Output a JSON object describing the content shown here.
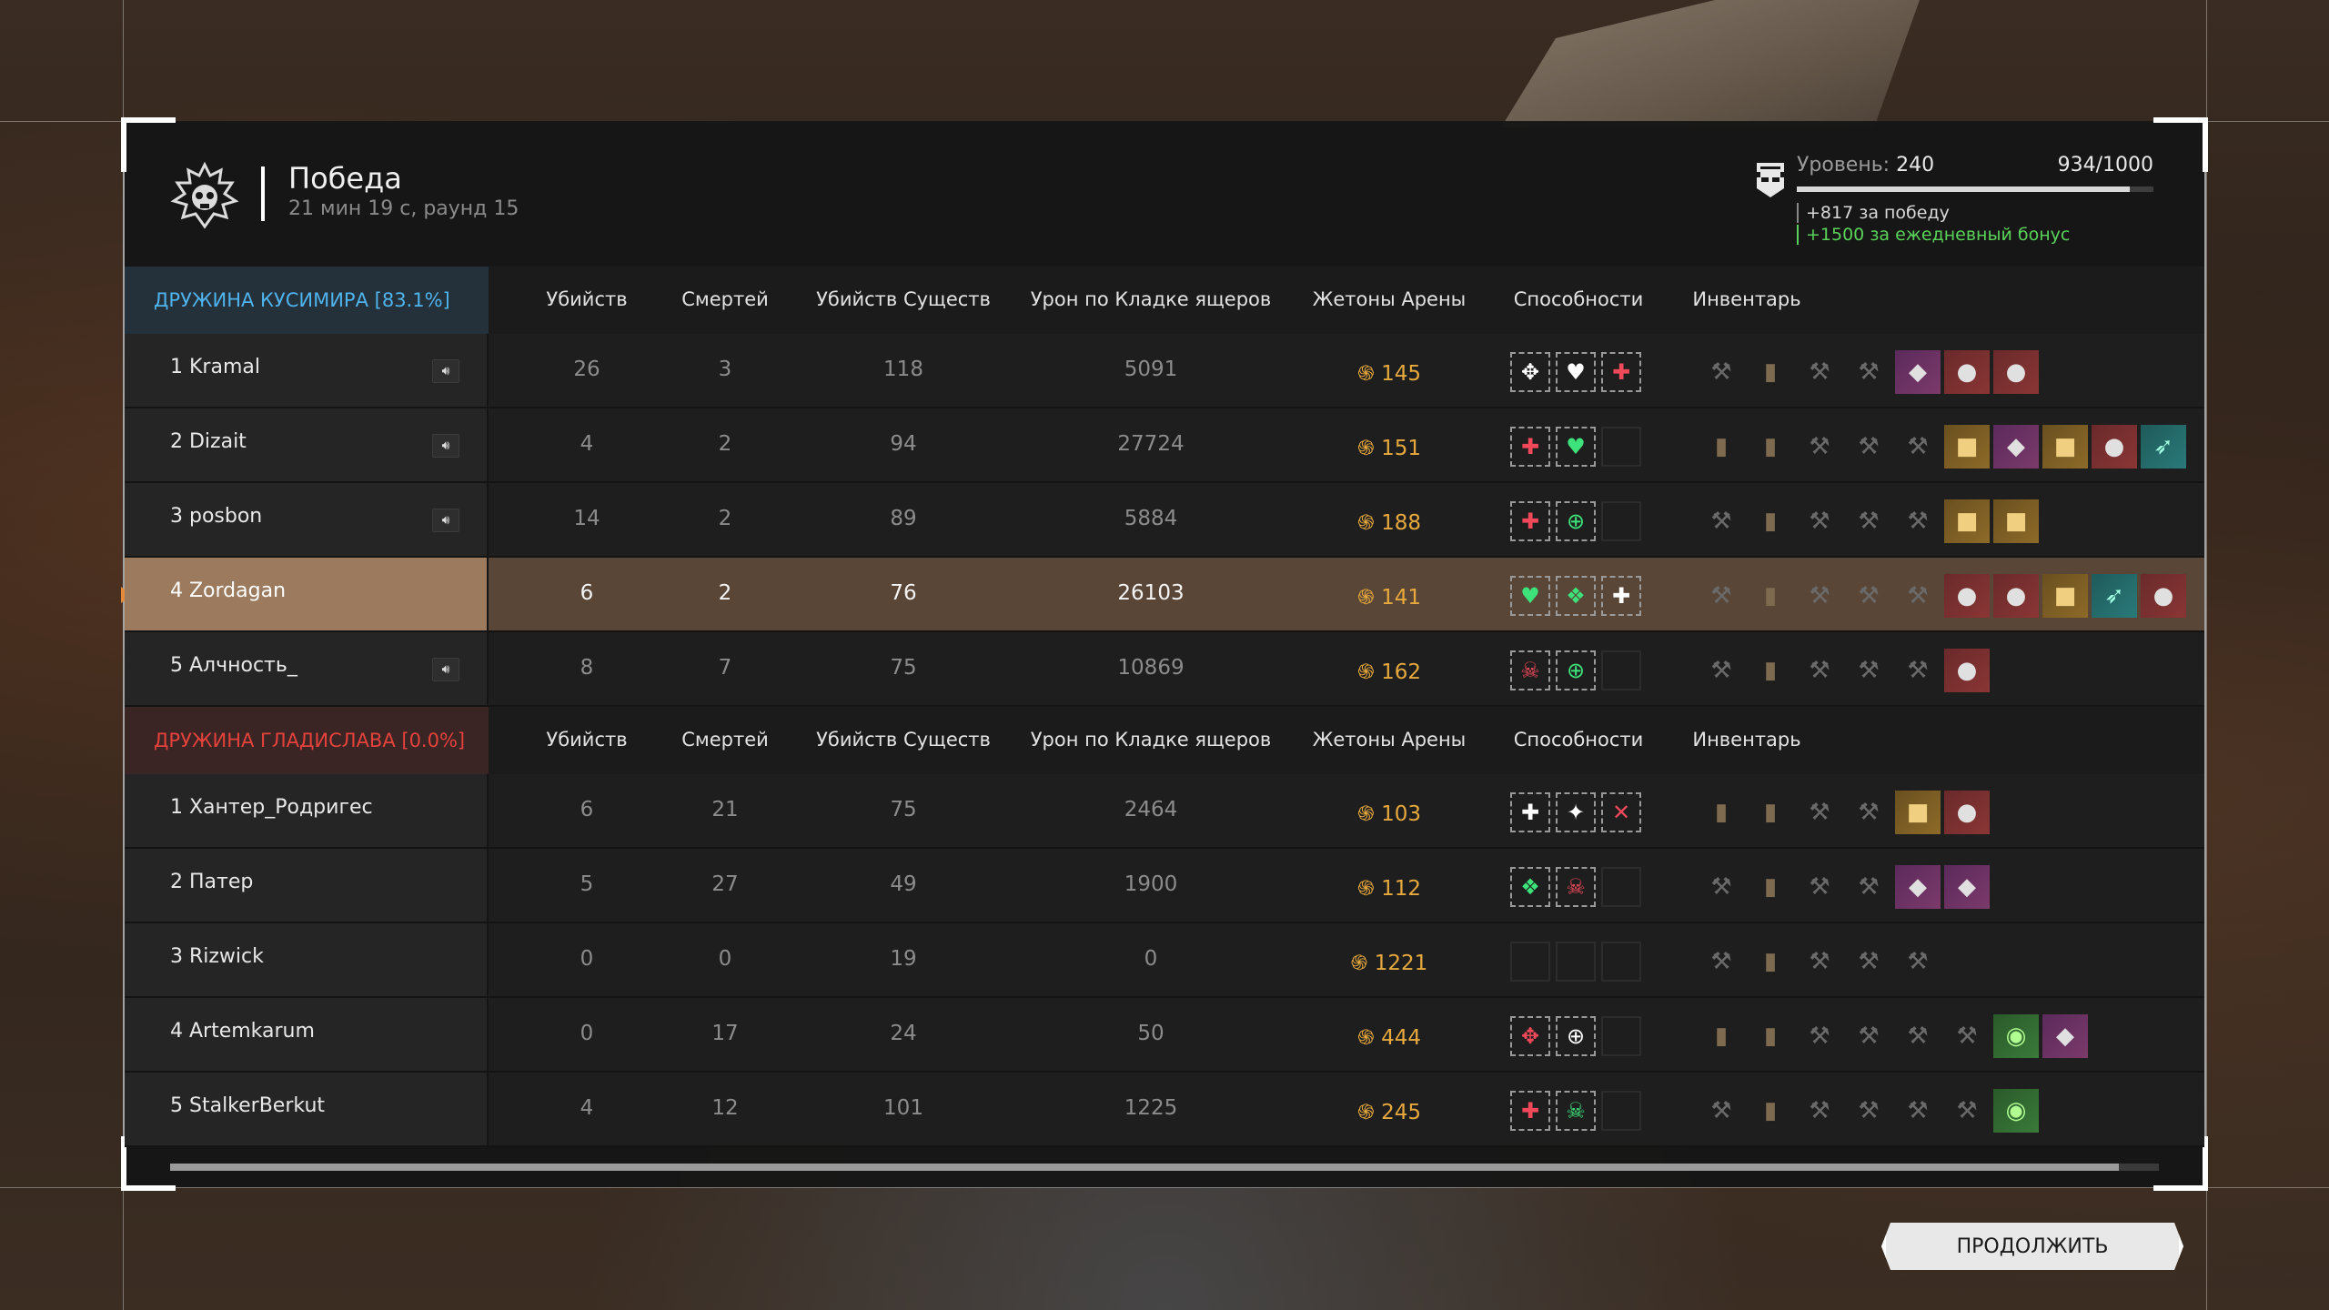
{
  "header": {
    "result_title": "Победа",
    "result_sub": "21 мин 19 с, раунд 15",
    "level_label": "Уровень:",
    "level_value": "240",
    "xp": "934/1000",
    "xp_progress": 0.934,
    "bonus_win": "+817 за победу",
    "bonus_daily": "+1500 за ежедневный бонус"
  },
  "columns": [
    "Убийств",
    "Смертей",
    "Убийств Существ",
    "Урон по Кладке ящеров",
    "Жетоны Арены",
    "Способности",
    "Инвентарь"
  ],
  "team1": {
    "name": "ДРУЖИНА КУСИМИРА [83.1%]",
    "color": "#4fb3ee",
    "players": [
      {
        "name": "1 Kramal",
        "kills": "26",
        "deaths": "3",
        "creatures": "118",
        "damage": "5091",
        "tokens": "145"
      },
      {
        "name": "2 Dizait",
        "kills": "4",
        "deaths": "2",
        "creatures": "94",
        "damage": "27724",
        "tokens": "151"
      },
      {
        "name": "3 posbon",
        "kills": "14",
        "deaths": "2",
        "creatures": "89",
        "damage": "5884",
        "tokens": "188"
      },
      {
        "name": "4 Zordagan",
        "kills": "6",
        "deaths": "2",
        "creatures": "76",
        "damage": "26103",
        "tokens": "141"
      },
      {
        "name": "5 Алчность_",
        "kills": "8",
        "deaths": "7",
        "creatures": "75",
        "damage": "10869",
        "tokens": "162"
      }
    ]
  },
  "team2": {
    "name": "ДРУЖИНА ГЛАДИСЛАВА [0.0%]",
    "color": "#e5423c",
    "players": [
      {
        "name": "1 Хантер_Родригес",
        "kills": "6",
        "deaths": "21",
        "creatures": "75",
        "damage": "2464",
        "tokens": "103"
      },
      {
        "name": "2 Патер",
        "kills": "5",
        "deaths": "27",
        "creatures": "49",
        "damage": "1900",
        "tokens": "112"
      },
      {
        "name": "3 Rizwick",
        "kills": "0",
        "deaths": "0",
        "creatures": "19",
        "damage": "0",
        "tokens": "1221"
      },
      {
        "name": "4 Artemkarum",
        "kills": "0",
        "deaths": "17",
        "creatures": "24",
        "damage": "50",
        "tokens": "444"
      },
      {
        "name": "5 StalkerBerkut",
        "kills": "4",
        "deaths": "12",
        "creatures": "101",
        "damage": "1225",
        "tokens": "245"
      }
    ]
  },
  "continue_label": "ПРОДОЛЖИТЬ",
  "coin_symbol": "֍"
}
